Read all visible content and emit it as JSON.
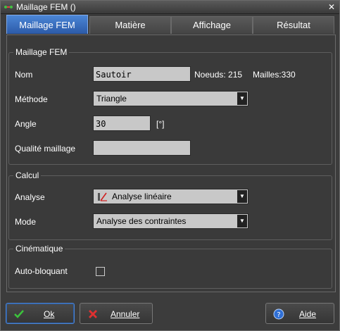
{
  "window": {
    "title": "Maillage FEM ()"
  },
  "tabs": [
    {
      "label": "Maillage FEM"
    },
    {
      "label": "Matière"
    },
    {
      "label": "Affichage"
    },
    {
      "label": "Résultat"
    }
  ],
  "groups": {
    "mesh": {
      "title": "Maillage FEM",
      "name_label": "Nom",
      "name_value": "Sautoir",
      "nodes_text": "Noeuds: 215",
      "meshes_text": "Mailles:330",
      "method_label": "Méthode",
      "method_value": "Triangle",
      "angle_label": "Angle",
      "angle_value": "30",
      "angle_unit": "[°]",
      "quality_label": "Qualité maillage",
      "quality_value": ""
    },
    "calc": {
      "title": "Calcul",
      "analysis_label": "Analyse",
      "analysis_value": "Analyse linéaire",
      "mode_label": "Mode",
      "mode_value": "Analyse des contraintes"
    },
    "kinematic": {
      "title": "Cinématique",
      "autolock_label": "Auto-bloquant",
      "autolock_checked": false
    }
  },
  "buttons": {
    "ok": "Ok",
    "cancel": "Annuler",
    "help": "Aide"
  }
}
